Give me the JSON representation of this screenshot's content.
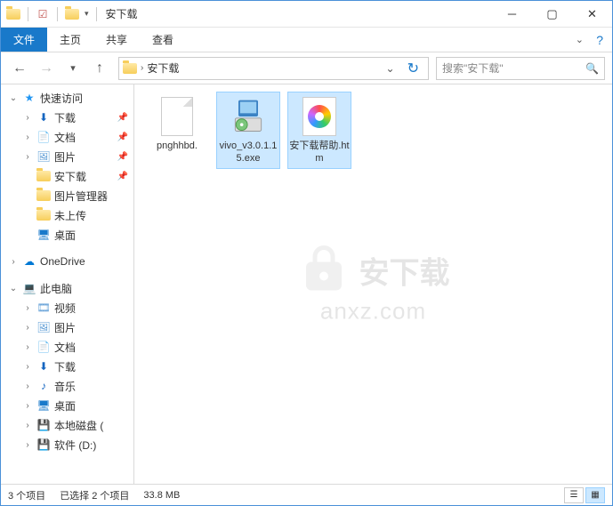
{
  "title": "安下载",
  "ribbon": {
    "tabs": [
      "文件",
      "主页",
      "共享",
      "查看"
    ],
    "active": 0
  },
  "address": {
    "crumb": "安下载"
  },
  "search": {
    "placeholder": "搜索\"安下载\""
  },
  "sidebar": {
    "quick_access": "快速访问",
    "items": [
      {
        "label": "下载",
        "icon": "download",
        "pinned": true
      },
      {
        "label": "文档",
        "icon": "document",
        "pinned": true
      },
      {
        "label": "图片",
        "icon": "pictures",
        "pinned": true
      },
      {
        "label": "安下载",
        "icon": "folder",
        "pinned": true
      },
      {
        "label": "图片管理器",
        "icon": "folder",
        "pinned": false
      },
      {
        "label": "未上传",
        "icon": "folder",
        "pinned": false
      },
      {
        "label": "桌面",
        "icon": "desktop",
        "pinned": false
      }
    ],
    "onedrive": "OneDrive",
    "this_pc": "此电脑",
    "pc_items": [
      {
        "label": "视频",
        "icon": "videos"
      },
      {
        "label": "图片",
        "icon": "pictures"
      },
      {
        "label": "文档",
        "icon": "document"
      },
      {
        "label": "下载",
        "icon": "download"
      },
      {
        "label": "音乐",
        "icon": "music"
      },
      {
        "label": "桌面",
        "icon": "desktop"
      },
      {
        "label": "本地磁盘 (",
        "icon": "drive"
      },
      {
        "label": "软件 (D:)",
        "icon": "drive"
      }
    ]
  },
  "files": [
    {
      "name": "pnghhbd.",
      "type": "blank",
      "selected": false
    },
    {
      "name": "vivo_v3.0.1.15.exe",
      "type": "exe",
      "selected": true
    },
    {
      "name": "安下载帮助.htm",
      "type": "htm",
      "selected": true
    }
  ],
  "status": {
    "items": "3 个项目",
    "selected": "已选择 2 个项目",
    "size": "33.8 MB"
  },
  "watermark": {
    "line1": "安下载",
    "line2": "anxz.com"
  }
}
